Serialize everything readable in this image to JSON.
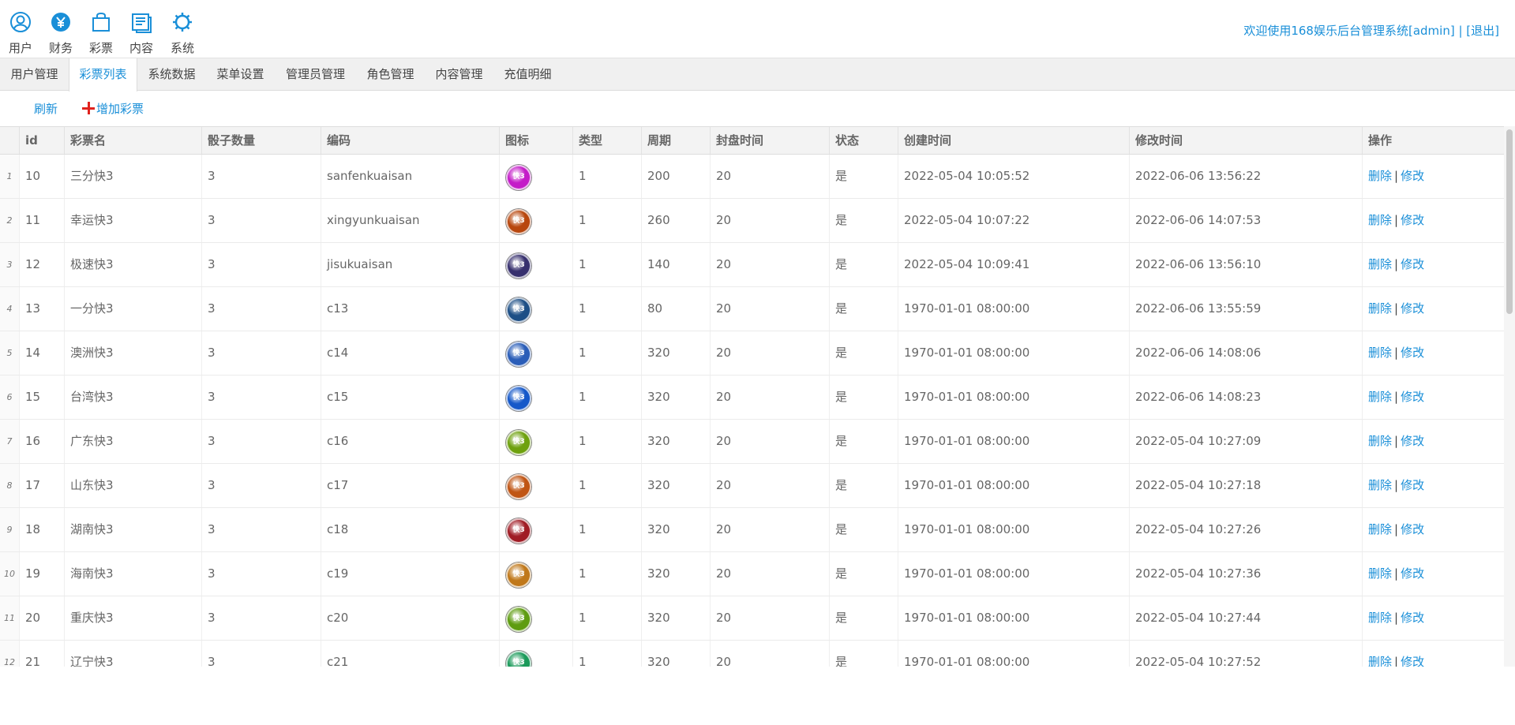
{
  "modules": [
    {
      "label": "用户",
      "icon": "user-icon"
    },
    {
      "label": "财务",
      "icon": "yen-icon"
    },
    {
      "label": "彩票",
      "icon": "bag-icon"
    },
    {
      "label": "内容",
      "icon": "document-icon"
    },
    {
      "label": "系统",
      "icon": "gear-icon"
    }
  ],
  "welcome": {
    "text": "欢迎使用168娱乐后台管理系统[admin] | ",
    "logout": "[退出]"
  },
  "tabs": [
    "用户管理",
    "彩票列表",
    "系统数据",
    "菜单设置",
    "管理员管理",
    "角色管理",
    "内容管理",
    "充值明细"
  ],
  "active_tab": "彩票列表",
  "toolbar": {
    "refresh": "刷新",
    "add": "增加彩票"
  },
  "table": {
    "headers": [
      "id",
      "彩票名",
      "骰子数量",
      "编码",
      "图标",
      "类型",
      "周期",
      "封盘时间",
      "状态",
      "创建时间",
      "修改时间",
      "操作"
    ],
    "action_delete": "删除",
    "action_edit": "修改",
    "action_sep": "|",
    "rows": [
      {
        "n": "1",
        "id": "10",
        "name": "三分快3",
        "dice": "3",
        "code": "sanfenkuaisan",
        "color": "#c41cc8",
        "type": "1",
        "period": "200",
        "close": "20",
        "status": "是",
        "created": "2022-05-04 10:05:52",
        "modified": "2022-06-06 13:56:22"
      },
      {
        "n": "2",
        "id": "11",
        "name": "幸运快3",
        "dice": "3",
        "code": "xingyunkuaisan",
        "color": "#b8470e",
        "type": "1",
        "period": "260",
        "close": "20",
        "status": "是",
        "created": "2022-05-04 10:07:22",
        "modified": "2022-06-06 14:07:53"
      },
      {
        "n": "3",
        "id": "12",
        "name": "极速快3",
        "dice": "3",
        "code": "jisukuaisan",
        "color": "#37306e",
        "type": "1",
        "period": "140",
        "close": "20",
        "status": "是",
        "created": "2022-05-04 10:09:41",
        "modified": "2022-06-06 13:56:10"
      },
      {
        "n": "4",
        "id": "13",
        "name": "一分快3",
        "dice": "3",
        "code": "c13",
        "color": "#1d4f86",
        "type": "1",
        "period": "80",
        "close": "20",
        "status": "是",
        "created": "1970-01-01 08:00:00",
        "modified": "2022-06-06 13:55:59"
      },
      {
        "n": "5",
        "id": "14",
        "name": "澳洲快3",
        "dice": "3",
        "code": "c14",
        "color": "#2a5db8",
        "type": "1",
        "period": "320",
        "close": "20",
        "status": "是",
        "created": "1970-01-01 08:00:00",
        "modified": "2022-06-06 14:08:06"
      },
      {
        "n": "6",
        "id": "15",
        "name": "台湾快3",
        "dice": "3",
        "code": "c15",
        "color": "#1558c9",
        "type": "1",
        "period": "320",
        "close": "20",
        "status": "是",
        "created": "1970-01-01 08:00:00",
        "modified": "2022-06-06 14:08:23"
      },
      {
        "n": "7",
        "id": "16",
        "name": "广东快3",
        "dice": "3",
        "code": "c16",
        "color": "#6ea10e",
        "type": "1",
        "period": "320",
        "close": "20",
        "status": "是",
        "created": "1970-01-01 08:00:00",
        "modified": "2022-05-04 10:27:09"
      },
      {
        "n": "8",
        "id": "17",
        "name": "山东快3",
        "dice": "3",
        "code": "c17",
        "color": "#c05514",
        "type": "1",
        "period": "320",
        "close": "20",
        "status": "是",
        "created": "1970-01-01 08:00:00",
        "modified": "2022-05-04 10:27:18"
      },
      {
        "n": "9",
        "id": "18",
        "name": "湖南快3",
        "dice": "3",
        "code": "c18",
        "color": "#a01c25",
        "type": "1",
        "period": "320",
        "close": "20",
        "status": "是",
        "created": "1970-01-01 08:00:00",
        "modified": "2022-05-04 10:27:26"
      },
      {
        "n": "10",
        "id": "19",
        "name": "海南快3",
        "dice": "3",
        "code": "c19",
        "color": "#c0781a",
        "type": "1",
        "period": "320",
        "close": "20",
        "status": "是",
        "created": "1970-01-01 08:00:00",
        "modified": "2022-05-04 10:27:36"
      },
      {
        "n": "11",
        "id": "20",
        "name": "重庆快3",
        "dice": "3",
        "code": "c20",
        "color": "#5e9c10",
        "type": "1",
        "period": "320",
        "close": "20",
        "status": "是",
        "created": "1970-01-01 08:00:00",
        "modified": "2022-05-04 10:27:44"
      },
      {
        "n": "12",
        "id": "21",
        "name": "辽宁快3",
        "dice": "3",
        "code": "c21",
        "color": "#1a9a5a",
        "type": "1",
        "period": "320",
        "close": "20",
        "status": "是",
        "created": "1970-01-01 08:00:00",
        "modified": "2022-05-04 10:27:52"
      }
    ]
  }
}
